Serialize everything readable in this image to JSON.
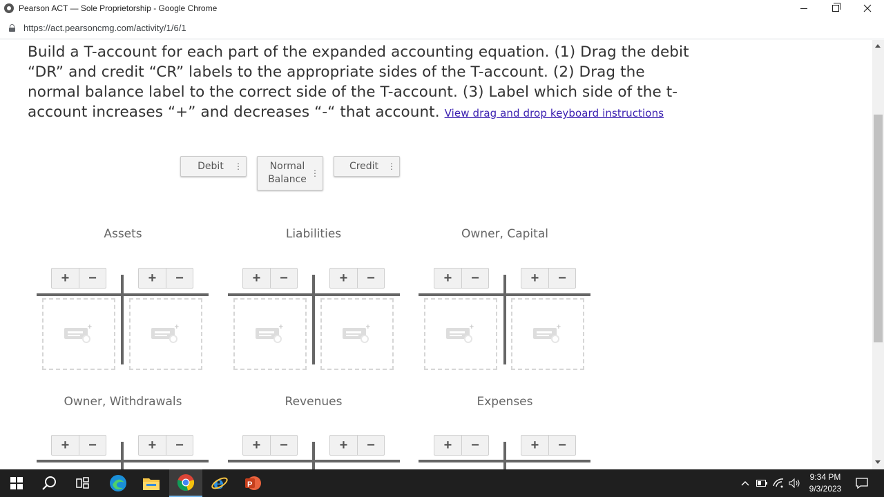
{
  "window": {
    "title": "Pearson ACT — Sole Proprietorship - Google Chrome",
    "url": "https://act.pearsoncmg.com/activity/1/6/1"
  },
  "instructions": {
    "text": "Build a T-account for each part of the expanded accounting equation. (1) Drag the debit “DR” and credit “CR” labels to the appropriate sides of the T-account. (2) Drag the normal balance label to the correct side of the T-account. (3) Label which side of the t-account increases “+” and decreases “-“ that account.",
    "link": "View drag and drop keyboard instructions"
  },
  "chips": {
    "debit": "Debit",
    "normal_line1": "Normal",
    "normal_line2": "Balance",
    "credit": "Credit"
  },
  "accounts": {
    "a1": "Assets",
    "a2": "Liabilities",
    "a3": "Owner, Capital",
    "a4": "Owner, Withdrawals",
    "a5": "Revenues",
    "a6": "Expenses"
  },
  "controls": {
    "plus": "+",
    "minus": "−"
  },
  "taskbar": {
    "time": "9:34 PM",
    "date": "9/3/2023"
  },
  "icons": [
    "windows-start-icon",
    "search-icon",
    "task-view-icon",
    "edge-icon",
    "file-explorer-icon",
    "chrome-icon",
    "internet-explorer-icon",
    "powerpoint-icon"
  ]
}
